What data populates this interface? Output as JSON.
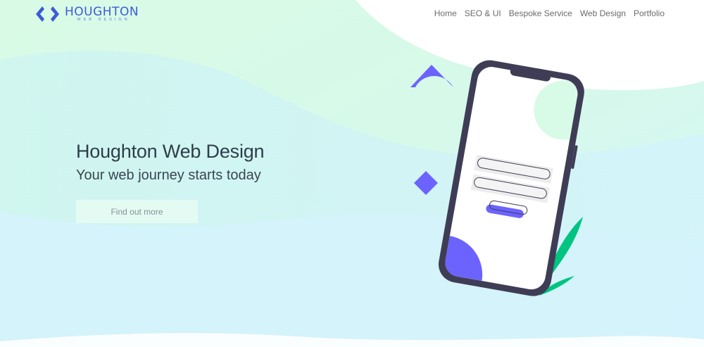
{
  "brand": {
    "name": "HOUGHTON",
    "tagline": "WEB DESIGN",
    "logo_icon": "chevrons-logo-icon",
    "color": "#3d5ad8"
  },
  "nav": {
    "items": [
      {
        "label": "Home"
      },
      {
        "label": "SEO & UI"
      },
      {
        "label": "Bespoke Service"
      },
      {
        "label": "Web Design"
      },
      {
        "label": "Portfolio"
      }
    ]
  },
  "hero": {
    "title": "Houghton Web Design",
    "subtitle": "Your web journey starts today",
    "cta_label": "Find out more"
  },
  "colors": {
    "accent": "#6c63ff",
    "leaf": "#00c47f",
    "phone_frame": "#3f3d56",
    "mint": "#d6fbe6",
    "cyan": "#d6f5fb"
  },
  "illustration": {
    "icon": "phone-login-illustration"
  }
}
